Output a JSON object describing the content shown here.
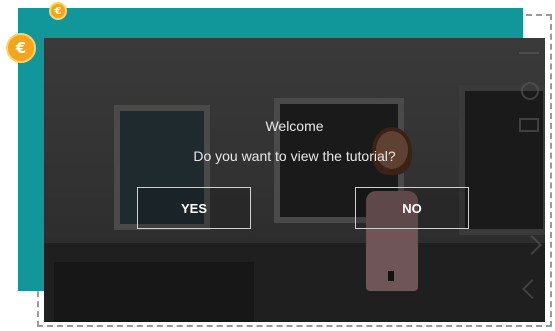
{
  "coins": {
    "small_symbol": "€",
    "large_symbol": "€"
  },
  "dialog": {
    "title": "Welcome",
    "question": "Do you want to view the tutorial?",
    "yes_label": "YES",
    "no_label": "NO"
  },
  "colors": {
    "teal_panel": "#11979a",
    "coin": "#f3a51c"
  }
}
